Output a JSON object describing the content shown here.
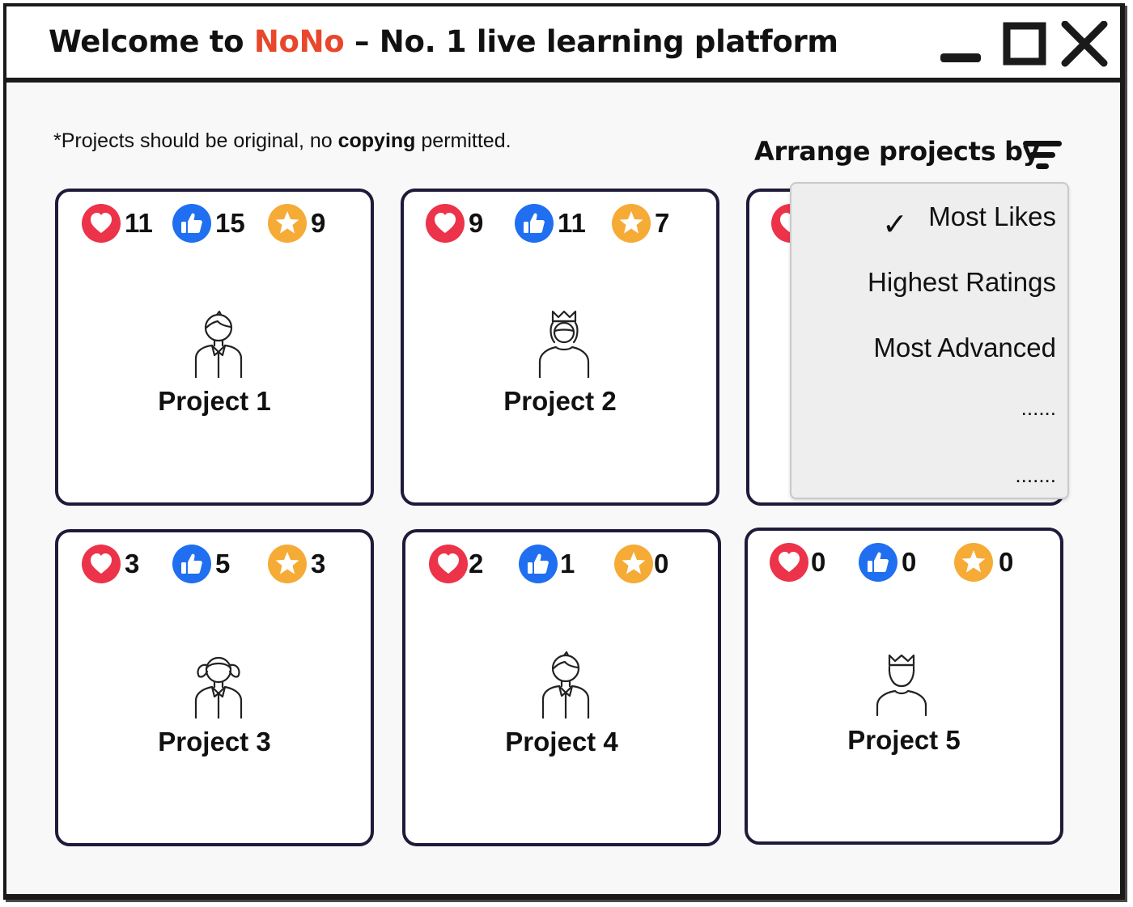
{
  "window": {
    "title_prefix": "Welcome to ",
    "title_brand": "NoNo",
    "title_suffix": " – No. 1 live learning platform",
    "brand_color": "#e8472b",
    "controls": [
      "minimize-icon",
      "maximize-icon",
      "close-icon"
    ]
  },
  "notice": {
    "prefix": "*Projects should be original, no ",
    "bold": "copying",
    "suffix": " permitted."
  },
  "sort": {
    "label": "Arrange projects by",
    "icon": "filter-icon",
    "options": [
      {
        "label": "Most Likes",
        "selected": true
      },
      {
        "label": "Highest Ratings",
        "selected": false
      },
      {
        "label": "Most Advanced",
        "selected": false
      },
      {
        "label": "......",
        "selected": false
      },
      {
        "label": ".......",
        "selected": false
      }
    ],
    "check_mark": "✓"
  },
  "stat_icons": {
    "love": {
      "icon": "heart-icon",
      "color": "#ec3349"
    },
    "like": {
      "icon": "thumbs-up-icon",
      "color": "#1f6ff0"
    },
    "star": {
      "icon": "star-icon",
      "color": "#f5ab35"
    }
  },
  "projects": [
    {
      "name": "Project 1",
      "loves": "11",
      "likes": "15",
      "stars": "9",
      "avatar": "boy-avatar-icon"
    },
    {
      "name": "Project 2",
      "loves": "9",
      "likes": "11",
      "stars": "7",
      "avatar": "crowned-girl-avatar-icon"
    },
    {
      "name": "",
      "loves": "",
      "likes": "",
      "stars": "",
      "avatar": ""
    },
    {
      "name": "Project 3",
      "loves": "3",
      "likes": "5",
      "stars": "3",
      "avatar": "girl-avatar-icon"
    },
    {
      "name": "Project 4",
      "loves": "2",
      "likes": "1",
      "stars": "0",
      "avatar": "boy-avatar-icon"
    },
    {
      "name": "Project 5",
      "loves": "0",
      "likes": "0",
      "stars": "0",
      "avatar": "crowned-person-avatar-icon"
    }
  ]
}
